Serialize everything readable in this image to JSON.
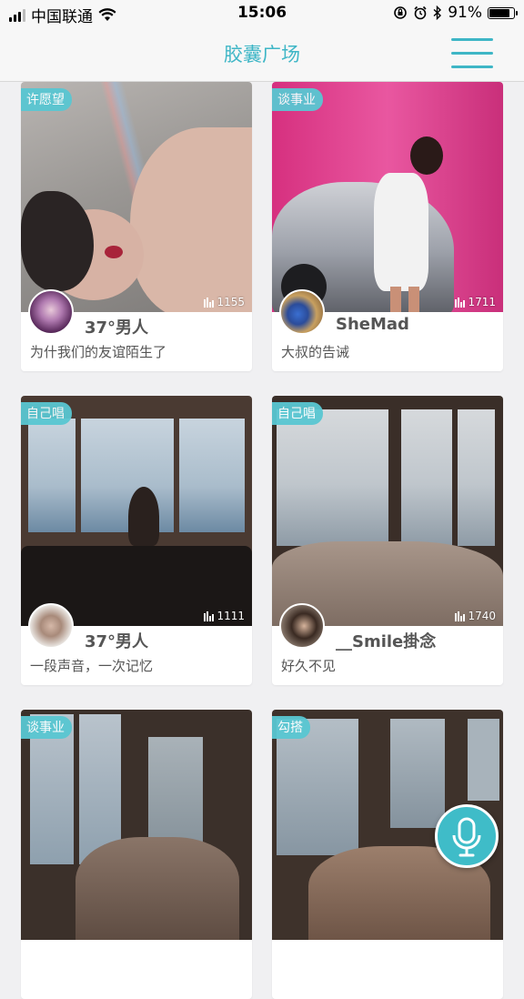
{
  "status_bar": {
    "carrier": "中国联通",
    "time": "15:06",
    "battery": "91%",
    "battery_level": 0.91
  },
  "nav": {
    "title": "胶囊广场",
    "menu_icon": "hamburger-menu-icon"
  },
  "colors": {
    "accent": "#3eb6c6",
    "tag": "#59c7d2"
  },
  "cards": [
    {
      "tag": "许愿望",
      "plays": "1155",
      "name": "37°男人",
      "desc": "为什我们的友谊陌生了"
    },
    {
      "tag": "谈事业",
      "plays": "1711",
      "name": "SheMad",
      "desc": "大叔的告诫"
    },
    {
      "tag": "自己唱",
      "plays": "1111",
      "name": "37°男人",
      "desc": "一段声音，一次记忆"
    },
    {
      "tag": "自己唱",
      "plays": "1740",
      "name": "__Smile掛念",
      "desc": "好久不见"
    },
    {
      "tag": "谈事业",
      "plays": "",
      "name": "",
      "desc": ""
    },
    {
      "tag": "勾搭",
      "plays": "",
      "name": "",
      "desc": ""
    }
  ],
  "fab": {
    "icon": "microphone-icon"
  }
}
